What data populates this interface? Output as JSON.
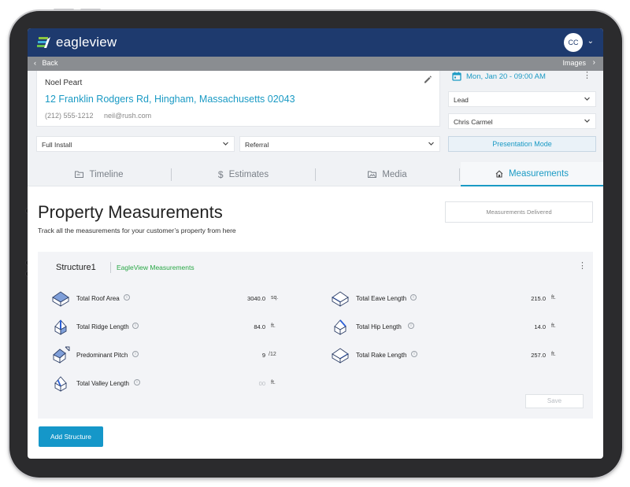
{
  "header": {
    "logo_text": "eagleview",
    "avatar_initials": "CC",
    "brand_color": "#1e3a6e",
    "accent_color": "#1a9ac4"
  },
  "backbar": {
    "back_label": "Back",
    "images_label": "Images"
  },
  "customer": {
    "name": "Noel Peart",
    "address": "12 Franklin Rodgers Rd, Hingham, Massachusetts 02043",
    "phone": "(212) 555-1212",
    "email": "neil@rush.com"
  },
  "appointment": {
    "datetime": "Mon, Jan 20 - 09:00 AM"
  },
  "selects": {
    "status": "Lead",
    "assignee": "Chris Carmel",
    "job_type": "Full Install",
    "source": "Referral"
  },
  "presentation_label": "Presentation Mode",
  "tabs": [
    {
      "label": "Timeline",
      "icon": "folder-icon"
    },
    {
      "label": "Estimates",
      "icon": "dollar-icon"
    },
    {
      "label": "Media",
      "icon": "image-folder-icon"
    },
    {
      "label": "Measurements",
      "icon": "home-icon",
      "active": true
    }
  ],
  "page": {
    "title": "Property Measurements",
    "subtitle": "Track all the measurements for your customer’s property from here",
    "delivered_label": "Measurements Delivered"
  },
  "structure": {
    "name": "Structure1",
    "source": "EagleView Measurements",
    "measurements": [
      {
        "label": "Total Roof Area",
        "value": "3040.0",
        "unit": "sq.",
        "icon": "roof-area-icon"
      },
      {
        "label": "Total Ridge Length",
        "value": "84.0",
        "unit": "ft.",
        "icon": "roof-ridge-icon"
      },
      {
        "label": "Predominant Pitch",
        "value": "9",
        "unit": "/12",
        "icon": "roof-pitch-icon"
      },
      {
        "label": "Total Valley Length",
        "value": "00",
        "unit": "ft.",
        "icon": "roof-valley-icon"
      },
      {
        "label": "Total Eave Length",
        "value": "215.0",
        "unit": "ft.",
        "icon": "roof-eave-icon"
      },
      {
        "label": "Total Hip Length",
        "value": "14.0",
        "unit": "ft.",
        "icon": "roof-hip-icon"
      },
      {
        "label": "Total Rake Length",
        "value": "257.0",
        "unit": "ft.",
        "icon": "roof-rake-icon"
      }
    ],
    "save_label": "Save"
  },
  "add_structure_label": "Add Structure"
}
